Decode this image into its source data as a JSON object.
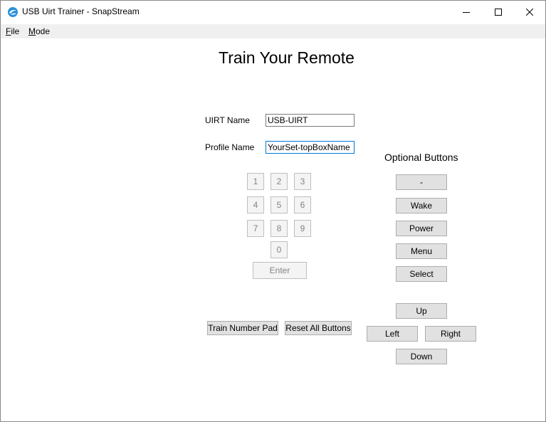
{
  "window": {
    "title": "USB Uirt Trainer - SnapStream"
  },
  "menu": {
    "file_accel": "F",
    "file_rest": "ile",
    "mode_accel": "M",
    "mode_rest": "ode"
  },
  "heading": "Train Your Remote",
  "form": {
    "uirt_label": "UIRT Name",
    "uirt_value": "USB-UIRT",
    "profile_label": "Profile Name",
    "profile_value": "YourSet-topBoxName"
  },
  "keypad": {
    "keys": [
      "1",
      "2",
      "3",
      "4",
      "5",
      "6",
      "7",
      "8",
      "9",
      "0"
    ],
    "enter": "Enter"
  },
  "actions": {
    "train": "Train Number Pad",
    "reset": "Reset All Buttons"
  },
  "optional": {
    "heading": "Optional Buttons",
    "dash": "-",
    "wake": "Wake",
    "power": "Power",
    "menu": "Menu",
    "select": "Select",
    "up": "Up",
    "left": "Left",
    "right": "Right",
    "down": "Down"
  },
  "colors": {
    "menubar": "#f0f0f0",
    "button": "#e1e1e1",
    "focus_border": "#0078d7"
  }
}
